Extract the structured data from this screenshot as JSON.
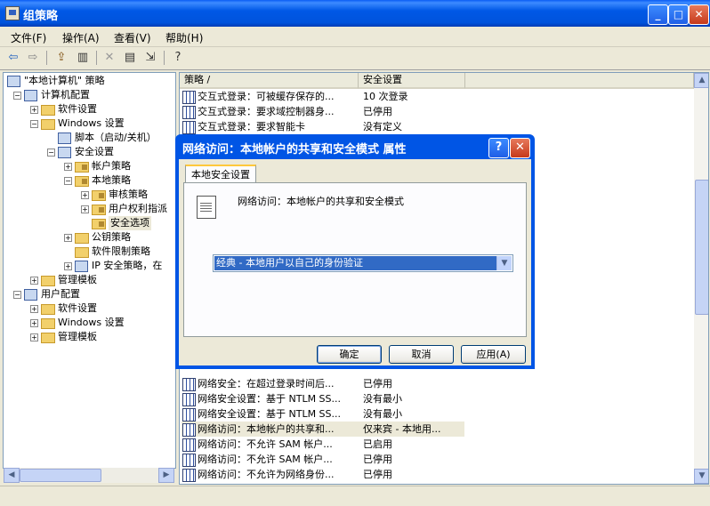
{
  "window": {
    "title": "组策略"
  },
  "menu": [
    "文件(F)",
    "操作(A)",
    "查看(V)",
    "帮助(H)"
  ],
  "toolbar_icons": [
    "back-icon",
    "forward-icon",
    "up-folder-icon",
    "show-hide-tree-icon",
    "delete-icon",
    "properties-icon",
    "export-list-icon",
    "help-icon"
  ],
  "tree": [
    {
      "label": "\"本地计算机\" 策略",
      "level": 0,
      "icon": "computer-policy-icon",
      "expander": ""
    },
    {
      "label": "计算机配置",
      "level": 1,
      "icon": "computer-icon",
      "expander": "−"
    },
    {
      "label": "软件设置",
      "level": 2,
      "icon": "folder-icon",
      "expander": "+"
    },
    {
      "label": "Windows 设置",
      "level": 2,
      "icon": "folder-icon",
      "expander": "−"
    },
    {
      "label": "脚本（启动/关机）",
      "level": 3,
      "icon": "script-icon",
      "expander": ""
    },
    {
      "label": "安全设置",
      "level": 3,
      "icon": "security-icon",
      "expander": "−"
    },
    {
      "label": "帐户策略",
      "level": 4,
      "icon": "folder-lock-icon",
      "expander": "+"
    },
    {
      "label": "本地策略",
      "level": 4,
      "icon": "folder-lock-icon",
      "expander": "−"
    },
    {
      "label": "审核策略",
      "level": 5,
      "icon": "folder-lock-icon",
      "expander": "+"
    },
    {
      "label": "用户权利指派",
      "level": 5,
      "icon": "folder-lock-icon",
      "expander": "+"
    },
    {
      "label": "安全选项",
      "level": 5,
      "icon": "folder-lock-icon",
      "expander": ""
    },
    {
      "label": "公钥策略",
      "level": 4,
      "icon": "folder-icon",
      "expander": "+"
    },
    {
      "label": "软件限制策略",
      "level": 4,
      "icon": "folder-icon",
      "expander": ""
    },
    {
      "label": "IP 安全策略，在",
      "level": 4,
      "icon": "ip-security-icon",
      "expander": "+"
    },
    {
      "label": "管理模板",
      "level": 2,
      "icon": "folder-icon",
      "expander": "+"
    },
    {
      "label": "用户配置",
      "level": 1,
      "icon": "user-icon",
      "expander": "−"
    },
    {
      "label": "软件设置",
      "level": 2,
      "icon": "folder-icon",
      "expander": "+"
    },
    {
      "label": "Windows 设置",
      "level": 2,
      "icon": "folder-icon",
      "expander": "+"
    },
    {
      "label": "管理模板",
      "level": 2,
      "icon": "folder-icon",
      "expander": "+"
    }
  ],
  "list": {
    "columns": [
      "策略 /",
      "安全设置"
    ],
    "rows_top": [
      {
        "policy": "交互式登录：可被缓存保存的...",
        "setting": "10 次登录"
      },
      {
        "policy": "交互式登录：要求域控制器身...",
        "setting": "已停用"
      },
      {
        "policy": "交互式登录：要求智能卡",
        "setting": "没有定义"
      }
    ],
    "rows_bottom": [
      {
        "policy": "网络安全：在超过登录时间后...",
        "setting": "已停用"
      },
      {
        "policy": "网络安全设置：基于 NTLM SS...",
        "setting": "没有最小"
      },
      {
        "policy": "网络安全设置：基于 NTLM SS...",
        "setting": "没有最小"
      },
      {
        "policy": "网络访问：本地帐户的共享和...",
        "setting": "仅来宾 - 本地用..."
      },
      {
        "policy": "网络访问：不允许 SAM 帐户...",
        "setting": "已启用"
      },
      {
        "policy": "网络访问：不允许 SAM 帐户...",
        "setting": "已停用"
      },
      {
        "policy": "网络访问：不允许为网络身份...",
        "setting": "已停用"
      }
    ]
  },
  "dialog": {
    "title": "网络访问：本地帐户的共享和安全模式 属性",
    "help_glyph": "?",
    "close_glyph": "✕",
    "tab": "本地安全设置",
    "setting_name": "网络访问：本地帐户的共享和安全模式",
    "combo_value": "经典 - 本地用户以自己的身份验证",
    "ok": "确定",
    "cancel": "取消",
    "apply": "应用(A)"
  }
}
